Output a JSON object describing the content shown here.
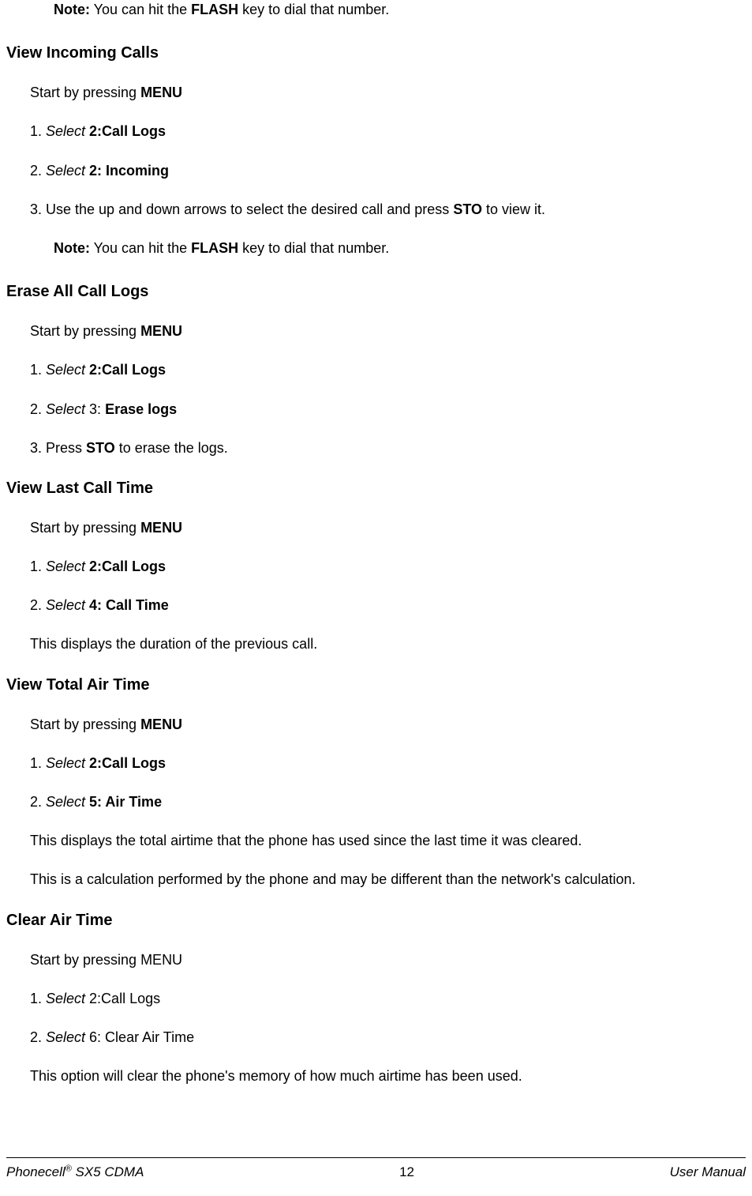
{
  "top_note_prefix": "Note:",
  "top_note_text1": " You can hit the ",
  "top_note_flash": "FLASH",
  "top_note_text2": " key to dial that number.",
  "s1": {
    "heading": "View Incoming Calls",
    "start_prefix": "Start by pressing ",
    "start_menu": "MENU",
    "item1_num": "1. ",
    "item1_select": "Select ",
    "item1_bold": "2:Call Logs",
    "item2_num": "2. ",
    "item2_select": "Select ",
    "item2_bold": "2: Incoming",
    "item3_num": "3. Use the up and down arrows to select the desired call and press ",
    "item3_sto": "STO",
    "item3_tail": " to view it.",
    "note_prefix": "Note:",
    "note_text1": " You can hit the ",
    "note_flash": "FLASH",
    "note_text2": " key to dial that number."
  },
  "s2": {
    "heading": "Erase All Call Logs",
    "start_prefix": "Start by pressing ",
    "start_menu": "MENU",
    "item1_num": "1. ",
    "item1_select": "Select ",
    "item1_bold": "2:Call Logs",
    "item2_num": "2. ",
    "item2_select": "Select ",
    "item2_mid": "3: ",
    "item2_bold": "Erase logs",
    "item3_pre": "3. Press ",
    "item3_sto": "STO",
    "item3_tail": " to erase the logs."
  },
  "s3": {
    "heading": "View Last Call Time",
    "start_prefix": "Start by pressing ",
    "start_menu": "MENU",
    "item1_num": "1. ",
    "item1_select": "Select ",
    "item1_bold": "2:Call Logs",
    "item2_num": "2. ",
    "item2_select": "Select ",
    "item2_bold": "4: Call Time",
    "desc": "This displays the duration of the previous call."
  },
  "s4": {
    "heading": "View Total Air Time",
    "start_prefix": "Start by pressing ",
    "start_menu": "MENU",
    "item1_num": "1. ",
    "item1_select": "Select ",
    "item1_bold": "2:Call Logs",
    "item2_num": "2. ",
    "item2_select": "Select ",
    "item2_bold": "5: Air Time",
    "desc1": "This displays the total airtime that the phone has used since the last time it was cleared.",
    "desc2": "This is a calculation performed by the phone and may be different than the network's calculation."
  },
  "s5": {
    "heading": "Clear Air Time",
    "start": "Start by pressing MENU",
    "item1_num": "1. ",
    "item1_select": "Select ",
    "item1_tail": "2:Call Logs",
    "item2_num": "2. ",
    "item2_select": "Select ",
    "item2_tail": "6: Clear Air Time",
    "desc": "This option will clear the phone's memory of how much airtime has been used."
  },
  "footer": {
    "left_pre": "Phonecell",
    "left_sup": "®",
    "left_post": " SX5 CDMA",
    "center": "12",
    "right": "User Manual"
  }
}
